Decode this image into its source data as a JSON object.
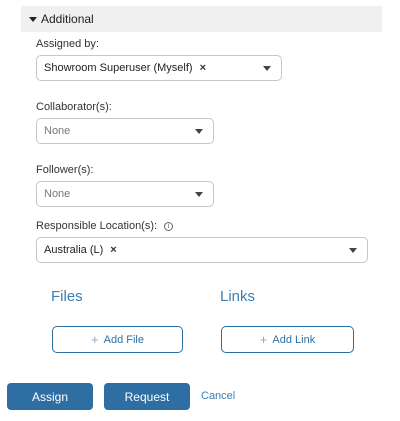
{
  "section": {
    "title": "Additional"
  },
  "assigned_by": {
    "label": "Assigned by:",
    "chips": [
      "Showroom Superuser (Myself)"
    ]
  },
  "collaborators": {
    "label": "Collaborator(s):",
    "placeholder": "None"
  },
  "followers": {
    "label": "Follower(s):",
    "placeholder": "None"
  },
  "responsible_location": {
    "label": "Responsible Location(s):",
    "chips": [
      "Australia (L)"
    ]
  },
  "files": {
    "title": "Files",
    "add_label": "Add File"
  },
  "links": {
    "title": "Links",
    "add_label": "Add Link"
  },
  "actions": {
    "assign": "Assign",
    "request": "Request",
    "cancel": "Cancel"
  },
  "icons": {
    "remove": "×",
    "add": "+",
    "info": "i"
  },
  "colors": {
    "primary": "#2e6ea3",
    "link": "#3a7fb5",
    "header_bg": "#f0f0f0",
    "border": "#c7c7c7"
  }
}
